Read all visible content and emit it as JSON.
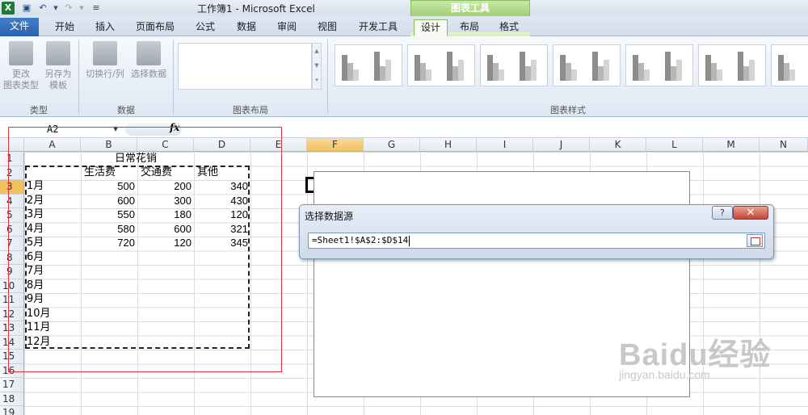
{
  "app": {
    "title": "工作簿1 - Microsoft Excel",
    "chart_tools_label": "图表工具"
  },
  "tabs": {
    "file": "文件",
    "home": "开始",
    "insert": "插入",
    "page_layout": "页面布局",
    "formulas": "公式",
    "data": "数据",
    "review": "审阅",
    "view": "视图",
    "developer": "开发工具",
    "design": "设计",
    "layout": "布局",
    "format": "格式"
  },
  "ribbon": {
    "change_type_line1": "更改",
    "change_type_line2": "图表类型",
    "save_template_line1": "另存为",
    "save_template_line2": "模板",
    "switch_row_col": "切换行/列",
    "select_data": "选择数据",
    "group_type": "类型",
    "group_data": "数据",
    "group_layout": "图表布局",
    "group_styles": "图表样式"
  },
  "formula_bar": {
    "name_box": "A2",
    "fx": "fx"
  },
  "sheet": {
    "columns": [
      "A",
      "B",
      "C",
      "D",
      "E",
      "F",
      "G",
      "H",
      "I",
      "J",
      "K",
      "L",
      "M",
      "N"
    ],
    "rows": [
      "1",
      "2",
      "3",
      "4",
      "5",
      "6",
      "7",
      "8",
      "9",
      "10",
      "11",
      "12",
      "13",
      "14",
      "15",
      "16",
      "17",
      "18",
      "19"
    ],
    "title": "日常花销",
    "headers": [
      "生活费",
      "交通费",
      "其他"
    ],
    "months": [
      "1月",
      "2月",
      "3月",
      "4月",
      "5月",
      "6月",
      "7月",
      "8月",
      "9月",
      "10月",
      "11月",
      "12月"
    ],
    "values": [
      [
        "500",
        "200",
        "340"
      ],
      [
        "600",
        "300",
        "430"
      ],
      [
        "550",
        "180",
        "120"
      ],
      [
        "580",
        "600",
        "321"
      ],
      [
        "720",
        "120",
        "345"
      ]
    ]
  },
  "dialog": {
    "title": "选择数据源",
    "help": "?",
    "close": "✕",
    "range": "=Sheet1!$A$2:$D$14"
  },
  "watermark": {
    "brand": "Baidu经验",
    "url": "jingyan.baidu.com"
  }
}
